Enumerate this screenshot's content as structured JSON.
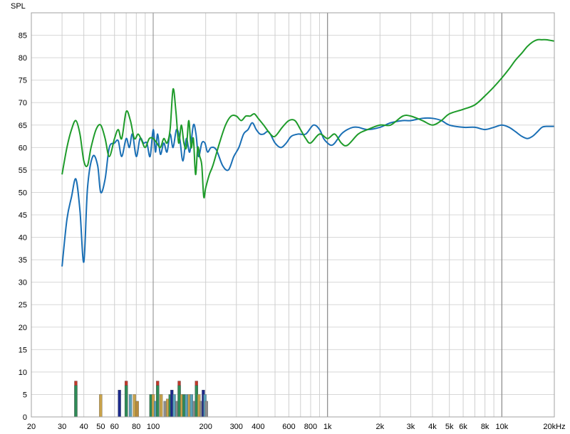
{
  "chart_data": {
    "type": "line",
    "ylabel": "SPL",
    "xscale": "log",
    "xlim": [
      20,
      20000
    ],
    "ylim": [
      0,
      90
    ],
    "grid": true,
    "x_tick_labels": [
      {
        "v": 20,
        "t": "20"
      },
      {
        "v": 30,
        "t": "30"
      },
      {
        "v": 40,
        "t": "40"
      },
      {
        "v": 50,
        "t": "50"
      },
      {
        "v": 60,
        "t": "60"
      },
      {
        "v": 80,
        "t": "80"
      },
      {
        "v": 100,
        "t": "100"
      },
      {
        "v": 200,
        "t": "200"
      },
      {
        "v": 300,
        "t": "300"
      },
      {
        "v": 400,
        "t": "400"
      },
      {
        "v": 600,
        "t": "600"
      },
      {
        "v": 800,
        "t": "800"
      },
      {
        "v": 1000,
        "t": "1k"
      },
      {
        "v": 2000,
        "t": "2k"
      },
      {
        "v": 3000,
        "t": "3k"
      },
      {
        "v": 4000,
        "t": "4k"
      },
      {
        "v": 5000,
        "t": "5k"
      },
      {
        "v": 6000,
        "t": "6k"
      },
      {
        "v": 8000,
        "t": "8k"
      },
      {
        "v": 10000,
        "t": "10k"
      },
      {
        "v": 20000,
        "t": "20kHz"
      }
    ],
    "y_ticks": [
      0,
      5,
      10,
      15,
      20,
      25,
      30,
      35,
      40,
      45,
      50,
      55,
      60,
      65,
      70,
      75,
      80,
      85
    ],
    "series": [
      {
        "color": "#1a6fb5",
        "x": [
          30,
          32,
          34,
          36,
          38,
          40,
          42,
          45,
          48,
          50,
          53,
          56,
          60,
          63,
          66,
          70,
          73,
          76,
          80,
          84,
          88,
          92,
          96,
          100,
          103,
          106,
          110,
          115,
          120,
          125,
          130,
          136,
          142,
          148,
          155,
          162,
          170,
          176,
          182,
          190,
          198,
          205,
          215,
          230,
          250,
          270,
          290,
          310,
          330,
          350,
          370,
          390,
          410,
          430,
          460,
          500,
          540,
          580,
          620,
          680,
          750,
          830,
          900,
          950,
          1000,
          1050,
          1100,
          1200,
          1300,
          1400,
          1500,
          1700,
          2000,
          2300,
          2700,
          3000,
          3500,
          4000,
          4500,
          5000,
          6000,
          7000,
          8000,
          9000,
          10000,
          11000,
          12000,
          13000,
          14000,
          15000,
          16000,
          17000,
          18000,
          20000
        ],
        "y": [
          33.5,
          44,
          49,
          53,
          46,
          34.5,
          51,
          58,
          56,
          50,
          53,
          60,
          61,
          61.5,
          58,
          62,
          60,
          63,
          58,
          62,
          61,
          61,
          58,
          64,
          59,
          63,
          58.5,
          61,
          59,
          63,
          60,
          64,
          62,
          57,
          62,
          59,
          65,
          63,
          58,
          61,
          61,
          59,
          60,
          59.5,
          56,
          55,
          58,
          60,
          63,
          64,
          65.5,
          64,
          63,
          63,
          63.5,
          61,
          60,
          61,
          62.5,
          63,
          63,
          65,
          64,
          62,
          61,
          60.5,
          61,
          63,
          64,
          64.5,
          64.5,
          64,
          64.5,
          65.5,
          66,
          66,
          66.5,
          66.5,
          66,
          65,
          64.5,
          64.5,
          64,
          64.5,
          65,
          64.5,
          63.5,
          62.5,
          62,
          62.5,
          63.5,
          64.5,
          64.7,
          64.7
        ]
      },
      {
        "color": "#1e9b2a",
        "x": [
          30,
          32,
          34,
          36,
          38,
          40,
          42,
          44,
          47,
          50,
          53,
          56,
          60,
          63,
          66,
          70,
          74,
          78,
          82,
          86,
          90,
          95,
          100,
          105,
          110,
          115,
          120,
          125,
          130,
          135,
          140,
          145,
          150,
          155,
          160,
          165,
          170,
          175,
          180,
          185,
          190,
          195,
          200,
          210,
          220,
          240,
          260,
          280,
          300,
          320,
          340,
          360,
          380,
          400,
          430,
          470,
          500,
          550,
          600,
          650,
          700,
          750,
          800,
          900,
          1000,
          1100,
          1200,
          1300,
          1500,
          1700,
          2000,
          2300,
          2700,
          3000,
          3500,
          4000,
          4500,
          5000,
          6000,
          7000,
          8000,
          9000,
          10000,
          11000,
          12000,
          13000,
          14000,
          15000,
          16000,
          17000,
          18000,
          20000
        ],
        "y": [
          54,
          60,
          64,
          66,
          63,
          57,
          56,
          60,
          64,
          65,
          62,
          58,
          62,
          64,
          62,
          68,
          66,
          62,
          63,
          61.5,
          60,
          62,
          62,
          61,
          60,
          62,
          61,
          64,
          73,
          68,
          61,
          65,
          61,
          60,
          66,
          60,
          62,
          54,
          60,
          58,
          56,
          49,
          51,
          54,
          56,
          61,
          65,
          67,
          67,
          66,
          67,
          67,
          67.5,
          66.5,
          65,
          63,
          62.5,
          64.5,
          66,
          66,
          64,
          62,
          61,
          63,
          62,
          63,
          61,
          60.5,
          63,
          64,
          65,
          65,
          67,
          67,
          66,
          65,
          66,
          67.5,
          68.5,
          69.5,
          71.5,
          73.5,
          75.5,
          77.5,
          79.5,
          81,
          82.5,
          83.5,
          84,
          84,
          84,
          83.7
        ]
      }
    ],
    "bars": [
      {
        "x": 36,
        "values": [
          8,
          7
        ],
        "colors": [
          "#c0392b",
          "#2e8b57"
        ]
      },
      {
        "x": 50,
        "values": [
          5
        ],
        "colors": [
          "#c8a24a"
        ]
      },
      {
        "x": 64,
        "values": [
          6
        ],
        "colors": [
          "#1c2a8c"
        ]
      },
      {
        "x": 70,
        "values": [
          8,
          7
        ],
        "colors": [
          "#c0392b",
          "#2e8b57"
        ]
      },
      {
        "x": 74,
        "values": [
          5
        ],
        "colors": [
          "#5aa0b8"
        ]
      },
      {
        "x": 78,
        "values": [
          5
        ],
        "colors": [
          "#c8a24a"
        ]
      },
      {
        "x": 81,
        "values": [
          3.5
        ],
        "colors": [
          "#b88c3c"
        ]
      },
      {
        "x": 97,
        "values": [
          5
        ],
        "colors": [
          "#2e8b57"
        ]
      },
      {
        "x": 100,
        "values": [
          5
        ],
        "colors": [
          "#c8a24a"
        ]
      },
      {
        "x": 103,
        "values": [
          3.5
        ],
        "colors": [
          "#5aa0b8"
        ]
      },
      {
        "x": 106,
        "values": [
          8,
          7
        ],
        "colors": [
          "#c0392b",
          "#2e8b57"
        ]
      },
      {
        "x": 111,
        "values": [
          5
        ],
        "colors": [
          "#c8a24a"
        ]
      },
      {
        "x": 117,
        "values": [
          3.5
        ],
        "colors": [
          "#8c8c8c"
        ]
      },
      {
        "x": 121,
        "values": [
          4
        ],
        "colors": [
          "#c8a24a"
        ]
      },
      {
        "x": 125,
        "values": [
          5
        ],
        "colors": [
          "#2e8b57"
        ]
      },
      {
        "x": 128,
        "values": [
          6
        ],
        "colors": [
          "#1c2a8c"
        ]
      },
      {
        "x": 132,
        "values": [
          5
        ],
        "colors": [
          "#5aa0b8"
        ]
      },
      {
        "x": 137,
        "values": [
          3.5
        ],
        "colors": [
          "#8c8c8c"
        ]
      },
      {
        "x": 141,
        "values": [
          8,
          7
        ],
        "colors": [
          "#c0392b",
          "#2e8b57"
        ]
      },
      {
        "x": 146,
        "values": [
          5
        ],
        "colors": [
          "#c8a24a"
        ]
      },
      {
        "x": 150,
        "values": [
          5
        ],
        "colors": [
          "#2e8b57"
        ]
      },
      {
        "x": 155,
        "values": [
          5
        ],
        "colors": [
          "#5aa0b8"
        ]
      },
      {
        "x": 161,
        "values": [
          5
        ],
        "colors": [
          "#c8a24a"
        ]
      },
      {
        "x": 166,
        "values": [
          5
        ],
        "colors": [
          "#5aa0b8"
        ]
      },
      {
        "x": 172,
        "values": [
          3.5
        ],
        "colors": [
          "#8c8c8c"
        ]
      },
      {
        "x": 177,
        "values": [
          8,
          7
        ],
        "colors": [
          "#c0392b",
          "#2e8b57"
        ]
      },
      {
        "x": 183,
        "values": [
          5
        ],
        "colors": [
          "#c8a24a"
        ]
      },
      {
        "x": 189,
        "values": [
          3.5
        ],
        "colors": [
          "#8c8c8c"
        ]
      },
      {
        "x": 194,
        "values": [
          6
        ],
        "colors": [
          "#1c2a8c"
        ]
      },
      {
        "x": 198,
        "values": [
          5
        ],
        "colors": [
          "#5aa0b8"
        ]
      },
      {
        "x": 202,
        "values": [
          3.5
        ],
        "colors": [
          "#8c8c8c"
        ]
      }
    ]
  }
}
